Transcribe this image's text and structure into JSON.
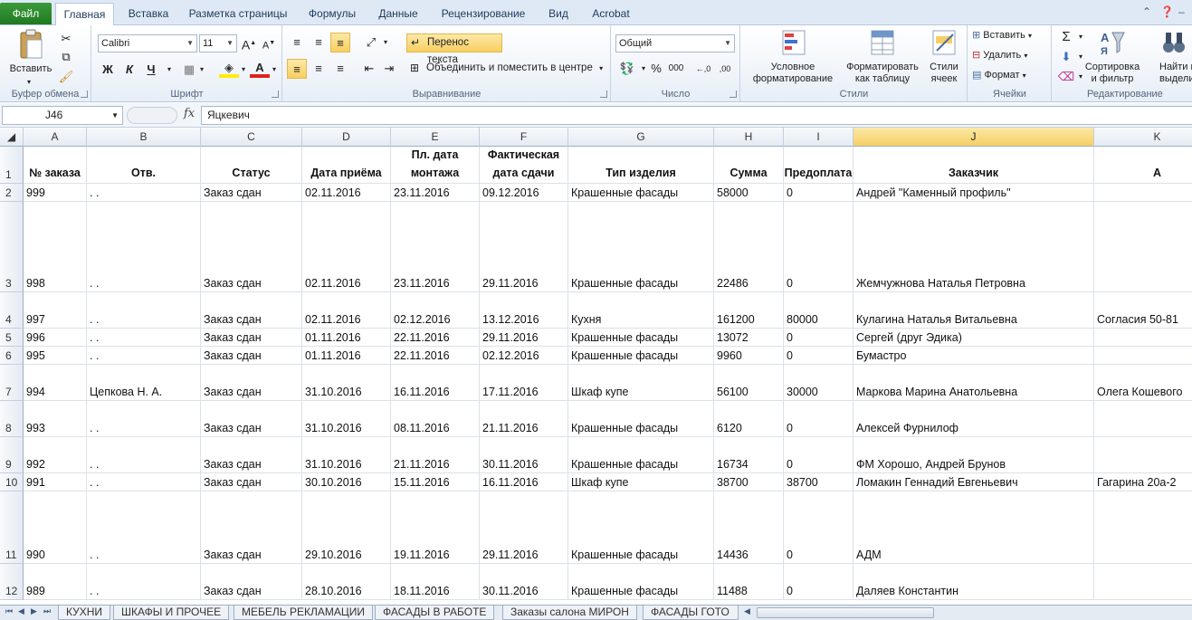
{
  "menu": {
    "file": "Файл",
    "tabs": [
      "Главная",
      "Вставка",
      "Разметка страницы",
      "Формулы",
      "Данные",
      "Рецензирование",
      "Вид",
      "Acrobat"
    ]
  },
  "ribbon": {
    "clipboard": {
      "label": "Буфер обмена",
      "paste": "Вставить"
    },
    "font": {
      "label": "Шрифт",
      "name": "Calibri",
      "size": "11",
      "bold": "Ж",
      "italic": "К",
      "underline": "Ч"
    },
    "alignment": {
      "label": "Выравнивание",
      "wrap": "Перенос текста",
      "merge": "Объединить и поместить в центре"
    },
    "number": {
      "label": "Число",
      "format": "Общий",
      "percent": "%",
      "thousands": "000"
    },
    "styles": {
      "label": "Стили",
      "conditional": "Условное\nформатирование",
      "as_table": "Форматировать\nкак таблицу",
      "cell_styles": "Стили\nячеек"
    },
    "cells": {
      "label": "Ячейки",
      "insert": "Вставить",
      "delete": "Удалить",
      "format": "Формат"
    },
    "editing": {
      "label": "Редактирование",
      "sort": "Сортировка\nи фильтр",
      "find": "Найти и\nвыделить"
    }
  },
  "formula_bar": {
    "cell_ref": "J46",
    "fx": "fx",
    "content": "Яцкевич"
  },
  "grid": {
    "columns": [
      "A",
      "B",
      "C",
      "D",
      "E",
      "F",
      "G",
      "H",
      "I",
      "J",
      "K"
    ],
    "selected_column": "J",
    "header_row": {
      "num": "1",
      "cells": [
        "№ заказа",
        "Отв.",
        "Статус",
        "Дата приёма",
        "Пл. дата монтажа",
        "Фактическая дата сдачи",
        "Тип изделия",
        "Сумма",
        "Предоплата",
        "Заказчик",
        "А"
      ]
    },
    "rows": [
      {
        "num": "2",
        "cells": [
          "999",
          ". .",
          "Заказ сдан",
          "02.11.2016",
          "23.11.2016",
          "09.12.2016",
          "Крашенные фасады",
          "58000",
          "0",
          "Андрей \"Каменный профиль\"",
          ""
        ]
      },
      {
        "num": "3",
        "cells": [
          "998",
          ". .",
          "Заказ сдан",
          "02.11.2016",
          "23.11.2016",
          "29.11.2016",
          "Крашенные фасады",
          "22486",
          "0",
          "Жемчужнова Наталья Петровна",
          ""
        ]
      },
      {
        "num": "4",
        "cells": [
          "997",
          ". .",
          "Заказ сдан",
          "02.11.2016",
          "02.12.2016",
          "13.12.2016",
          "Кухня",
          "161200",
          "80000",
          "Кулагина Наталья Витальевна",
          "Согласия 50-81"
        ]
      },
      {
        "num": "5",
        "cells": [
          "996",
          ". .",
          "Заказ сдан",
          "01.11.2016",
          "22.11.2016",
          "29.11.2016",
          "Крашенные фасады",
          "13072",
          "0",
          "Сергей (друг Эдика)",
          ""
        ]
      },
      {
        "num": "6",
        "cells": [
          "995",
          ". .",
          "Заказ сдан",
          "01.11.2016",
          "22.11.2016",
          "02.12.2016",
          "Крашенные фасады",
          "9960",
          "0",
          "Бумастро",
          ""
        ]
      },
      {
        "num": "7",
        "cells": [
          "994",
          "Цепкова Н. А.",
          "Заказ сдан",
          "31.10.2016",
          "16.11.2016",
          "17.11.2016",
          "Шкаф купе",
          "56100",
          "30000",
          "Маркова Марина Анатольевна",
          "Олега Кошевого"
        ]
      },
      {
        "num": "8",
        "cells": [
          "993",
          ". .",
          "Заказ сдан",
          "31.10.2016",
          "08.11.2016",
          "21.11.2016",
          "Крашенные фасады",
          "6120",
          "0",
          "Алексей Фурнилоф",
          ""
        ]
      },
      {
        "num": "9",
        "cells": [
          "992",
          ". .",
          "Заказ сдан",
          "31.10.2016",
          "21.11.2016",
          "30.11.2016",
          "Крашенные фасады",
          "16734",
          "0",
          "ФМ Хорошо, Андрей Брунов",
          ""
        ]
      },
      {
        "num": "10",
        "cells": [
          "991",
          ". .",
          "Заказ сдан",
          "30.10.2016",
          "15.11.2016",
          "16.11.2016",
          "Шкаф купе",
          "38700",
          "38700",
          "Ломакин Геннадий Евгеньевич",
          "Гагарина 20а-2"
        ]
      },
      {
        "num": "11",
        "cells": [
          "990",
          ". .",
          "Заказ сдан",
          "29.10.2016",
          "19.11.2016",
          "29.11.2016",
          "Крашенные фасады",
          "14436",
          "0",
          "АДМ",
          ""
        ]
      },
      {
        "num": "12",
        "cells": [
          "989",
          ". .",
          "Заказ сдан",
          "28.10.2016",
          "18.11.2016",
          "30.11.2016",
          "Крашенные фасады",
          "11488",
          "0",
          "Даляев Константин",
          ""
        ]
      }
    ]
  },
  "sheets": [
    "КУХНИ",
    "ШКАФЫ И ПРОЧЕЕ",
    "МЕБЕЛЬ РЕКЛАМАЦИИ",
    "ФАСАДЫ В РАБОТЕ",
    "Заказы салона МИРОН",
    "ФАСАДЫ ГОТО"
  ]
}
